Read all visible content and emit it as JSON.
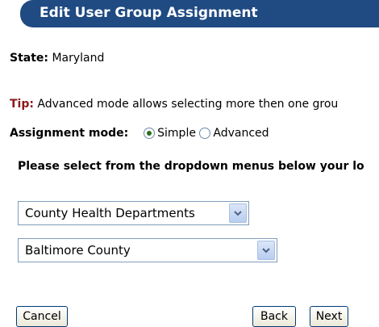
{
  "header": {
    "title": "Edit User Group Assignment"
  },
  "state": {
    "label": "State:",
    "value": "Maryland"
  },
  "tip": {
    "label": "Tip:",
    "text": "Advanced mode allows selecting more then one grou"
  },
  "assignment_mode": {
    "label": "Assignment mode:",
    "options": [
      {
        "label": "Simple",
        "checked": true
      },
      {
        "label": "Advanced",
        "checked": false
      }
    ]
  },
  "instruction": "Please select from the dropdown menus below your lo",
  "dropdowns": [
    {
      "selected": "County Health Departments"
    },
    {
      "selected": "Baltimore County"
    }
  ],
  "buttons": {
    "cancel": "Cancel",
    "back": "Back",
    "next": "Next"
  }
}
